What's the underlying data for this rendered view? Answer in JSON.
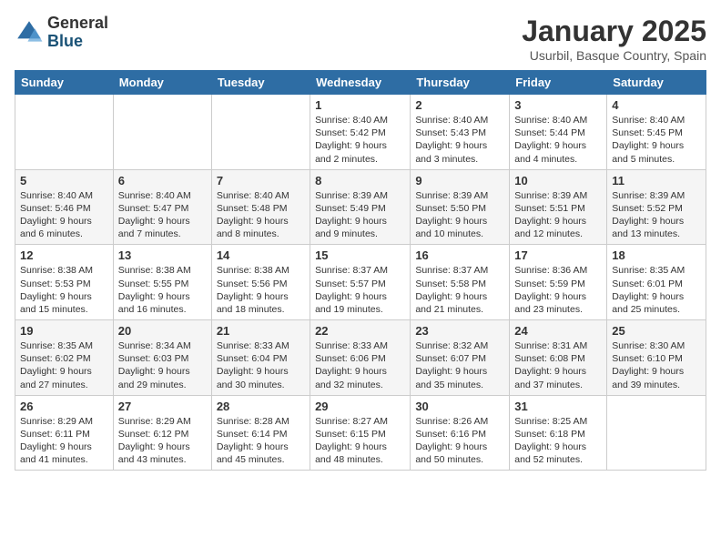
{
  "header": {
    "logo_general": "General",
    "logo_blue": "Blue",
    "month_title": "January 2025",
    "location": "Usurbil, Basque Country, Spain"
  },
  "weekdays": [
    "Sunday",
    "Monday",
    "Tuesday",
    "Wednesday",
    "Thursday",
    "Friday",
    "Saturday"
  ],
  "weeks": [
    [
      {
        "day": "",
        "info": ""
      },
      {
        "day": "",
        "info": ""
      },
      {
        "day": "",
        "info": ""
      },
      {
        "day": "1",
        "info": "Sunrise: 8:40 AM\nSunset: 5:42 PM\nDaylight: 9 hours\nand 2 minutes."
      },
      {
        "day": "2",
        "info": "Sunrise: 8:40 AM\nSunset: 5:43 PM\nDaylight: 9 hours\nand 3 minutes."
      },
      {
        "day": "3",
        "info": "Sunrise: 8:40 AM\nSunset: 5:44 PM\nDaylight: 9 hours\nand 4 minutes."
      },
      {
        "day": "4",
        "info": "Sunrise: 8:40 AM\nSunset: 5:45 PM\nDaylight: 9 hours\nand 5 minutes."
      }
    ],
    [
      {
        "day": "5",
        "info": "Sunrise: 8:40 AM\nSunset: 5:46 PM\nDaylight: 9 hours\nand 6 minutes."
      },
      {
        "day": "6",
        "info": "Sunrise: 8:40 AM\nSunset: 5:47 PM\nDaylight: 9 hours\nand 7 minutes."
      },
      {
        "day": "7",
        "info": "Sunrise: 8:40 AM\nSunset: 5:48 PM\nDaylight: 9 hours\nand 8 minutes."
      },
      {
        "day": "8",
        "info": "Sunrise: 8:39 AM\nSunset: 5:49 PM\nDaylight: 9 hours\nand 9 minutes."
      },
      {
        "day": "9",
        "info": "Sunrise: 8:39 AM\nSunset: 5:50 PM\nDaylight: 9 hours\nand 10 minutes."
      },
      {
        "day": "10",
        "info": "Sunrise: 8:39 AM\nSunset: 5:51 PM\nDaylight: 9 hours\nand 12 minutes."
      },
      {
        "day": "11",
        "info": "Sunrise: 8:39 AM\nSunset: 5:52 PM\nDaylight: 9 hours\nand 13 minutes."
      }
    ],
    [
      {
        "day": "12",
        "info": "Sunrise: 8:38 AM\nSunset: 5:53 PM\nDaylight: 9 hours\nand 15 minutes."
      },
      {
        "day": "13",
        "info": "Sunrise: 8:38 AM\nSunset: 5:55 PM\nDaylight: 9 hours\nand 16 minutes."
      },
      {
        "day": "14",
        "info": "Sunrise: 8:38 AM\nSunset: 5:56 PM\nDaylight: 9 hours\nand 18 minutes."
      },
      {
        "day": "15",
        "info": "Sunrise: 8:37 AM\nSunset: 5:57 PM\nDaylight: 9 hours\nand 19 minutes."
      },
      {
        "day": "16",
        "info": "Sunrise: 8:37 AM\nSunset: 5:58 PM\nDaylight: 9 hours\nand 21 minutes."
      },
      {
        "day": "17",
        "info": "Sunrise: 8:36 AM\nSunset: 5:59 PM\nDaylight: 9 hours\nand 23 minutes."
      },
      {
        "day": "18",
        "info": "Sunrise: 8:35 AM\nSunset: 6:01 PM\nDaylight: 9 hours\nand 25 minutes."
      }
    ],
    [
      {
        "day": "19",
        "info": "Sunrise: 8:35 AM\nSunset: 6:02 PM\nDaylight: 9 hours\nand 27 minutes."
      },
      {
        "day": "20",
        "info": "Sunrise: 8:34 AM\nSunset: 6:03 PM\nDaylight: 9 hours\nand 29 minutes."
      },
      {
        "day": "21",
        "info": "Sunrise: 8:33 AM\nSunset: 6:04 PM\nDaylight: 9 hours\nand 30 minutes."
      },
      {
        "day": "22",
        "info": "Sunrise: 8:33 AM\nSunset: 6:06 PM\nDaylight: 9 hours\nand 32 minutes."
      },
      {
        "day": "23",
        "info": "Sunrise: 8:32 AM\nSunset: 6:07 PM\nDaylight: 9 hours\nand 35 minutes."
      },
      {
        "day": "24",
        "info": "Sunrise: 8:31 AM\nSunset: 6:08 PM\nDaylight: 9 hours\nand 37 minutes."
      },
      {
        "day": "25",
        "info": "Sunrise: 8:30 AM\nSunset: 6:10 PM\nDaylight: 9 hours\nand 39 minutes."
      }
    ],
    [
      {
        "day": "26",
        "info": "Sunrise: 8:29 AM\nSunset: 6:11 PM\nDaylight: 9 hours\nand 41 minutes."
      },
      {
        "day": "27",
        "info": "Sunrise: 8:29 AM\nSunset: 6:12 PM\nDaylight: 9 hours\nand 43 minutes."
      },
      {
        "day": "28",
        "info": "Sunrise: 8:28 AM\nSunset: 6:14 PM\nDaylight: 9 hours\nand 45 minutes."
      },
      {
        "day": "29",
        "info": "Sunrise: 8:27 AM\nSunset: 6:15 PM\nDaylight: 9 hours\nand 48 minutes."
      },
      {
        "day": "30",
        "info": "Sunrise: 8:26 AM\nSunset: 6:16 PM\nDaylight: 9 hours\nand 50 minutes."
      },
      {
        "day": "31",
        "info": "Sunrise: 8:25 AM\nSunset: 6:18 PM\nDaylight: 9 hours\nand 52 minutes."
      },
      {
        "day": "",
        "info": ""
      }
    ]
  ]
}
